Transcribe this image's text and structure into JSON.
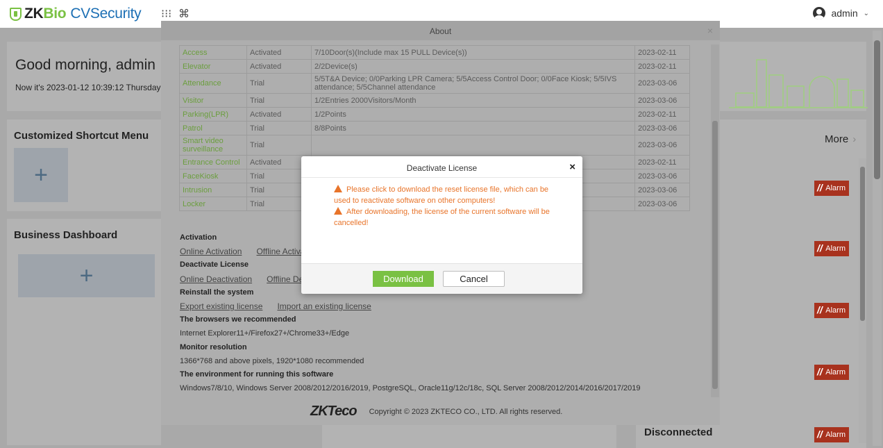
{
  "app": {
    "logo_zk": "ZK",
    "logo_bio": "Bio",
    "logo_product": "CVSecurity",
    "apps_icon": "grid-icon",
    "shortcut_icon": "command-icon",
    "user_name": "admin",
    "user_caret": "⌄"
  },
  "dashboard": {
    "greeting": "Good morning, admin",
    "time_text": "Now it's 2023-01-12 10:39:12 Thursday",
    "shortcut_title": "Customized Shortcut Menu",
    "business_title": "Business Dashboard",
    "plus": "+",
    "more_label": "More",
    "more_chevron": "›",
    "disconnected_label": "Disconnected",
    "alarm_label": "Alarm"
  },
  "about": {
    "title": "About",
    "close": "×",
    "modules": [
      {
        "module": "Access",
        "status": "Activated",
        "desc": "7/10Door(s)(Include max 15 PULL Device(s))",
        "date": "2023-02-11"
      },
      {
        "module": "Elevator",
        "status": "Activated",
        "desc": "2/2Device(s)",
        "date": "2023-02-11"
      },
      {
        "module": "Attendance",
        "status": "Trial",
        "desc": "5/5T&A Device; 0/0Parking LPR Camera; 5/5Access Control Door; 0/0Face Kiosk; 5/5IVS attendance; 5/5Channel attendance",
        "date": "2023-03-06"
      },
      {
        "module": "Visitor",
        "status": "Trial",
        "desc": "1/2Entries 2000Visitors/Month",
        "date": "2023-03-06"
      },
      {
        "module": "Parking(LPR)",
        "status": "Activated",
        "desc": "1/2Points",
        "date": "2023-02-11"
      },
      {
        "module": "Patrol",
        "status": "Trial",
        "desc": "8/8Points",
        "date": "2023-03-06"
      },
      {
        "module": "Smart video surveillance",
        "status": "Trial",
        "desc": "",
        "date": "2023-03-06"
      },
      {
        "module": "Entrance Control",
        "status": "Activated",
        "desc": "",
        "date": "2023-02-11"
      },
      {
        "module": "FaceKiosk",
        "status": "Trial",
        "desc": "",
        "date": "2023-03-06"
      },
      {
        "module": "Intrusion",
        "status": "Trial",
        "desc": "",
        "date": "2023-03-06"
      },
      {
        "module": "Locker",
        "status": "Trial",
        "desc": "",
        "date": "2023-03-06"
      }
    ],
    "activation_heading": "Activation",
    "online_activation": "Online Activation",
    "offline_activation": "Offline Activation",
    "deactivate_heading": "Deactivate License",
    "online_deactivation": "Online Deactivation",
    "offline_deactivation": "Offline Deactivation",
    "reinstall_heading": "Reinstall the system",
    "export_license": "Export existing license",
    "import_license": "Import an existing license",
    "browsers_heading": "The browsers we recommended",
    "browsers_text": "Internet Explorer11+/Firefox27+/Chrome33+/Edge",
    "resolution_heading": "Monitor resolution",
    "resolution_text": "1366*768 and above pixels, 1920*1080 recommended",
    "env_heading": "The environment for running this software",
    "env_text": "Windows7/8/10, Windows Server 2008/2012/2016/2019, PostgreSQL, Oracle11g/12c/18c, SQL Server 2008/2012/2014/2016/2017/2019",
    "footer_logo": "ZKTeco",
    "copyright": "Copyright © 2023 ZKTECO CO., LTD. All rights reserved."
  },
  "deactivate_dialog": {
    "title": "Deactivate License",
    "close": "×",
    "message1": "Please click to download the reset license file, which can be used to reactivate software on other computers!",
    "message2": "After downloading, the license of the current software will be cancelled!",
    "download_label": "Download",
    "cancel_label": "Cancel"
  },
  "colors": {
    "brand_green": "#7ac143",
    "brand_blue": "#1c6fb4",
    "warning_orange": "#e8742a",
    "alarm_red": "#a8321e"
  }
}
